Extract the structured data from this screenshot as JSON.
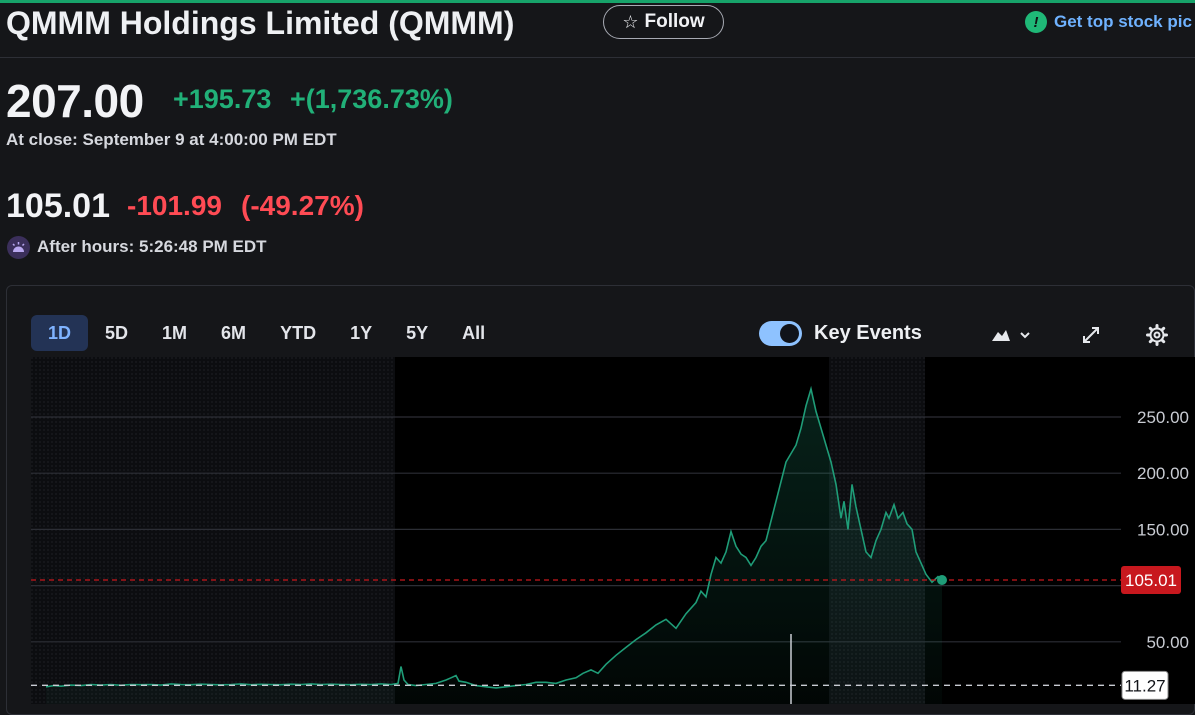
{
  "header": {
    "title": "QMMM Holdings Limited (QMMM)",
    "follow_label": "Follow",
    "promo_text": "Get top stock pic"
  },
  "quote": {
    "price": "207.00",
    "change": "+195.73",
    "change_pct": "+(1,736.73%)",
    "close_label": "At close: September 9 at 4:00:00 PM EDT",
    "after_price": "105.01",
    "after_change": "-101.99",
    "after_change_pct": "(-49.27%)",
    "after_label": "After hours: 5:26:48 PM EDT"
  },
  "chart_controls": {
    "ranges": [
      "1D",
      "5D",
      "1M",
      "6M",
      "YTD",
      "1Y",
      "5Y",
      "All"
    ],
    "active_range": "1D",
    "key_events_label": "Key Events",
    "key_events_on": true,
    "icons": [
      "mountain-chart-icon",
      "chevron-down-icon",
      "expand-icon",
      "gear-icon"
    ]
  },
  "colors": {
    "up": "#21b078",
    "down": "#ff4b54",
    "line": "#1f9d78",
    "current_marker": "#c8181e",
    "accent_tab": "#233355"
  },
  "chart_data": {
    "type": "area",
    "series": [
      {
        "values": [
          [
            0,
            10
          ],
          [
            8,
            11
          ],
          [
            15,
            10.5
          ],
          [
            25,
            11.5
          ],
          [
            35,
            11
          ],
          [
            45,
            12
          ],
          [
            55,
            11.5
          ],
          [
            65,
            12
          ],
          [
            75,
            11.3
          ],
          [
            85,
            12
          ],
          [
            95,
            11.8
          ],
          [
            105,
            12
          ],
          [
            115,
            11.5
          ],
          [
            125,
            12.5
          ],
          [
            135,
            12
          ],
          [
            145,
            11.8
          ],
          [
            155,
            12.3
          ],
          [
            165,
            12
          ],
          [
            175,
            11.7
          ],
          [
            185,
            12
          ],
          [
            195,
            12.5
          ],
          [
            205,
            11.8
          ],
          [
            215,
            12.2
          ],
          [
            225,
            12
          ],
          [
            235,
            11.8
          ],
          [
            245,
            12.3
          ],
          [
            255,
            12
          ],
          [
            265,
            12.5
          ],
          [
            275,
            12
          ],
          [
            285,
            12.3
          ],
          [
            295,
            12
          ],
          [
            305,
            11.8
          ],
          [
            315,
            12.2
          ],
          [
            325,
            12
          ],
          [
            335,
            12.5
          ],
          [
            345,
            12
          ],
          [
            352,
            13
          ],
          [
            355,
            28
          ],
          [
            358,
            16
          ],
          [
            362,
            12
          ],
          [
            370,
            11
          ],
          [
            380,
            12
          ],
          [
            390,
            13
          ],
          [
            400,
            16
          ],
          [
            405,
            18
          ],
          [
            410,
            20
          ],
          [
            413,
            15
          ],
          [
            420,
            14
          ],
          [
            430,
            11
          ],
          [
            440,
            10
          ],
          [
            450,
            9
          ],
          [
            460,
            10
          ],
          [
            470,
            11
          ],
          [
            480,
            12
          ],
          [
            490,
            14
          ],
          [
            500,
            14
          ],
          [
            510,
            13
          ],
          [
            520,
            16
          ],
          [
            530,
            18
          ],
          [
            537,
            22
          ],
          [
            545,
            25
          ],
          [
            552,
            22
          ],
          [
            560,
            30
          ],
          [
            570,
            38
          ],
          [
            580,
            45
          ],
          [
            590,
            52
          ],
          [
            600,
            58
          ],
          [
            610,
            65
          ],
          [
            620,
            70
          ],
          [
            630,
            62
          ],
          [
            640,
            75
          ],
          [
            650,
            85
          ],
          [
            655,
            95
          ],
          [
            660,
            90
          ],
          [
            665,
            110
          ],
          [
            670,
            125
          ],
          [
            675,
            120
          ],
          [
            680,
            130
          ],
          [
            685,
            148
          ],
          [
            690,
            135
          ],
          [
            695,
            128
          ],
          [
            700,
            125
          ],
          [
            705,
            118
          ],
          [
            710,
            125
          ],
          [
            715,
            135
          ],
          [
            720,
            140
          ],
          [
            730,
            175
          ],
          [
            740,
            210
          ],
          [
            750,
            225
          ],
          [
            755,
            240
          ],
          [
            760,
            260
          ],
          [
            765,
            275
          ],
          [
            770,
            255
          ],
          [
            775,
            240
          ],
          [
            780,
            225
          ],
          [
            785,
            210
          ],
          [
            790,
            190
          ],
          [
            795,
            160
          ],
          [
            798,
            175
          ],
          [
            802,
            150
          ],
          [
            806,
            190
          ],
          [
            810,
            170
          ],
          [
            815,
            150
          ],
          [
            820,
            130
          ],
          [
            825,
            125
          ],
          [
            830,
            140
          ],
          [
            835,
            150
          ],
          [
            840,
            165
          ],
          [
            843,
            160
          ],
          [
            848,
            172
          ],
          [
            852,
            160
          ],
          [
            857,
            165
          ],
          [
            861,
            155
          ],
          [
            866,
            150
          ],
          [
            870,
            130
          ],
          [
            875,
            120
          ],
          [
            880,
            110
          ],
          [
            886,
            103
          ],
          [
            892,
            108
          ],
          [
            896,
            105
          ]
        ]
      }
    ],
    "ylim": [
      0,
      300
    ],
    "y_ticks": [
      50,
      150,
      200,
      250
    ],
    "y_tick_labels": [
      "50.00",
      "150.00",
      "200.00",
      "250.00"
    ],
    "current_label": "105.01",
    "current_value": 105.01,
    "prev_close_label": "11.27",
    "prev_close_value": 11.27,
    "grid": true,
    "key_events_shaded": true
  }
}
